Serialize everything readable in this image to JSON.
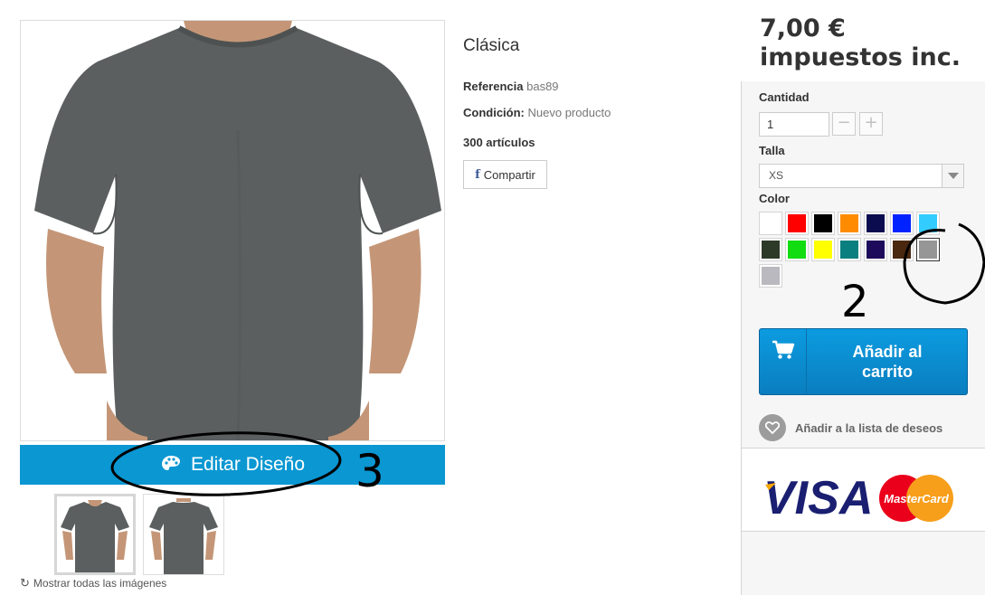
{
  "product": {
    "title": "Clásica",
    "reference_label": "Referencia",
    "reference_value": "bas89",
    "condition_label": "Condición:",
    "condition_value": "Nuevo producto",
    "stock": "300 artículos",
    "share_label": "Compartir",
    "share_icon": "facebook-icon",
    "shirt_color": "#5b5f5f"
  },
  "image": {
    "edit_label": "Editar Diseño",
    "edit_icon": "palette-icon",
    "show_all_label": "Mostrar todas las imágenes",
    "show_all_icon": "refresh-icon",
    "accent": "#0a97d2"
  },
  "buy": {
    "price_line1": "7,00 €",
    "price_line2": "impuestos inc.",
    "quantity_label": "Cantidad",
    "quantity_value": "1",
    "size_label": "Talla",
    "size_value": "XS",
    "color_label": "Color",
    "colors": [
      "#ffffff",
      "#ff0000",
      "#000000",
      "#ff8c00",
      "#0b0b4f",
      "#0022ff",
      "#33ccff",
      "#2e3a28",
      "#11dd11",
      "#ffff00",
      "#0a7f7f",
      "#1e0a5a",
      "#4a2810",
      "#969696",
      "#b9b9bf"
    ],
    "selected_color_index": 13,
    "cart_label_1": "Añadir al",
    "cart_label_2": "carrito",
    "cart_icon": "cart-icon",
    "wishlist_label": "Añadir a la lista de deseos",
    "wishlist_icon": "heart-icon"
  },
  "payment": {
    "visa": "VISA",
    "mastercard": "MasterCard"
  },
  "annotations": {
    "mark_2": "2",
    "mark_3": "3"
  }
}
